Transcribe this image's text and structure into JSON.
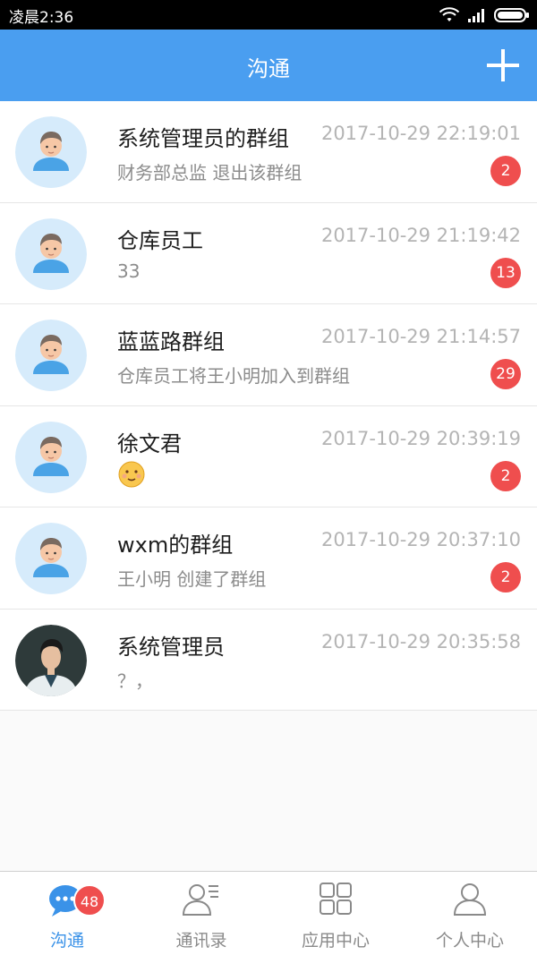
{
  "status_bar": {
    "time": "凌晨2:36"
  },
  "header": {
    "title": "沟通"
  },
  "conversations": [
    {
      "name": "系统管理员的群组",
      "time": "2017-10-29 22:19:01",
      "preview": "财务部总监 退出该群组",
      "unread": "2"
    },
    {
      "name": "仓库员工",
      "time": "2017-10-29 21:19:42",
      "preview": "33",
      "unread": "13"
    },
    {
      "name": "蓝蓝路群组",
      "time": "2017-10-29 21:14:57",
      "preview": "仓库员工将王小明加入到群组",
      "unread": "29"
    },
    {
      "name": "徐文君",
      "time": "2017-10-29 20:39:19",
      "preview": "",
      "unread": "2"
    },
    {
      "name": "wxm的群组",
      "time": "2017-10-29 20:37:10",
      "preview": "王小明 创建了群组",
      "unread": "2"
    },
    {
      "name": "系统管理员",
      "time": "2017-10-29 20:35:58",
      "preview": "？，",
      "unread": ""
    }
  ],
  "tabs": [
    {
      "label": "沟通",
      "icon": "chat-icon",
      "badge": "48",
      "active": true
    },
    {
      "label": "通讯录",
      "icon": "contacts-icon"
    },
    {
      "label": "应用中心",
      "icon": "apps-grid-icon"
    },
    {
      "label": "个人中心",
      "icon": "profile-icon"
    }
  ],
  "colors": {
    "header": "#4a9ef0",
    "badge": "#ef4e4e",
    "active_tab": "#3a92e8",
    "avatar_bg": "#d6ebfb"
  }
}
